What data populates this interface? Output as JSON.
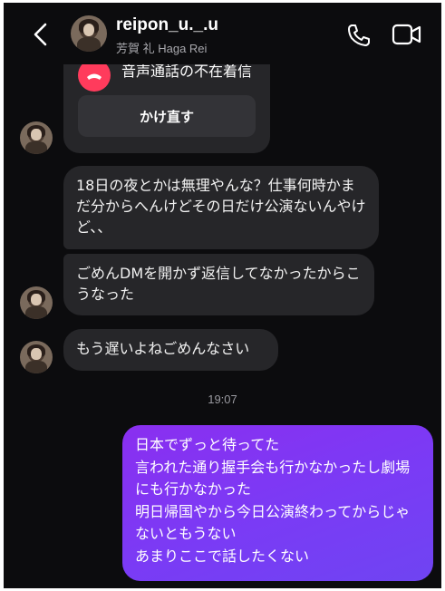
{
  "header": {
    "username": "reipon_u._.u",
    "subname": "芳賀 礼 Haga Rei"
  },
  "messages": {
    "call_card": {
      "text": "音声通話の不在着信",
      "button_label": "かけ直す"
    },
    "incoming_1": "18日の夜とかは無理やんな？仕事何時かまだ分からへんけどその日だけ公演ないんやけど、、",
    "incoming_2": "ごめんDMを開かず返信してなかったからこうなった",
    "incoming_3": "もう遅いよねごめんなさい",
    "timestamp": "19:07",
    "outgoing_1": "日本でずっと待ってた\n言われた通り握手会も行かなかったし劇場にも行かなかった\n明日帰国やから今日公演終わってからじゃないともうない\nあまりここで話したくない"
  },
  "icons": {
    "back": "chevron-left-icon",
    "call": "phone-icon",
    "video": "video-camera-icon",
    "missed_call": "missed-call-icon"
  },
  "colors": {
    "background": "#0c0c0e",
    "incoming_bubble": "#262629",
    "outgoing_bubble": "#7a3bf5",
    "missed_call": "#ff3b5c"
  }
}
